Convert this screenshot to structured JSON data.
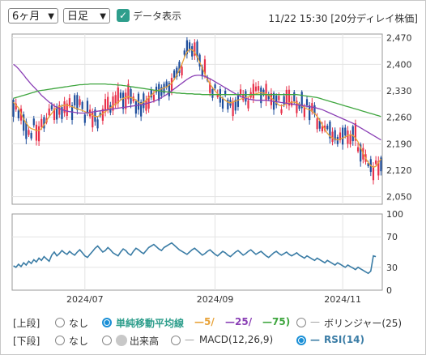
{
  "toolbar": {
    "period_select": "6ヶ月",
    "interval_select": "日足",
    "show_data_label": "データ表示",
    "show_data_checked": true,
    "datetime": "11/22 15:30 [20分ディレイ株価]"
  },
  "colors": {
    "up": "#e8304a",
    "down": "#1f4e9c",
    "ma5": "#e8a33a",
    "ma25": "#8a3fb5",
    "ma75": "#3fa63f",
    "rsi": "#3a7ca5",
    "accent": "#1a8fd6"
  },
  "chart_data": [
    {
      "type": "candlestick",
      "ylim": [
        2030,
        2480
      ],
      "yticks": [
        "2,470",
        "2,400",
        "2,330",
        "2,260",
        "2,190",
        "2,120",
        "2,050"
      ],
      "ytick_values": [
        2470,
        2400,
        2330,
        2260,
        2190,
        2120,
        2050
      ],
      "xticks": [
        "2024/07",
        "2024/09",
        "2024/11"
      ],
      "xtick_index": [
        28,
        79,
        129
      ],
      "series": [
        {
          "name": "5",
          "values": [
            2300,
            2292,
            2285,
            2270,
            2255,
            2245,
            2235,
            2230,
            2228,
            2225,
            2225,
            2230,
            2240,
            2250,
            2262,
            2270,
            2280,
            2285,
            2288,
            2290,
            2292,
            2292,
            2290,
            2288,
            2285,
            2282,
            2280,
            2278,
            2275,
            2272,
            2270,
            2265,
            2262,
            2262,
            2265,
            2270,
            2275,
            2280,
            2285,
            2290,
            2295,
            2300,
            2305,
            2310,
            2312,
            2315,
            2312,
            2310,
            2305,
            2300,
            2296,
            2300,
            2305,
            2312,
            2318,
            2325,
            2330,
            2332,
            2335,
            2338,
            2340,
            2345,
            2350,
            2360,
            2372,
            2385,
            2400,
            2418,
            2432,
            2440,
            2438,
            2432,
            2420,
            2405,
            2390,
            2375,
            2360,
            2348,
            2338,
            2330,
            2322,
            2315,
            2310,
            2305,
            2300,
            2298,
            2300,
            2303,
            2305,
            2308,
            2310,
            2312,
            2314,
            2318,
            2320,
            2322,
            2324,
            2325,
            2324,
            2322,
            2318,
            2312,
            2305,
            2298,
            2292,
            2290,
            2292,
            2295,
            2298,
            2300,
            2300,
            2298,
            2294,
            2290,
            2286,
            2282,
            2280,
            2276,
            2270,
            2262,
            2252,
            2240,
            2228,
            2218,
            2210,
            2205,
            2202,
            2200,
            2202,
            2205,
            2208,
            2212,
            2214,
            2212,
            2205,
            2195,
            2180,
            2165,
            2152,
            2140,
            2132,
            2128,
            2130,
            2140,
            2150
          ]
        },
        {
          "name": "25",
          "values": [
            2400,
            2395,
            2388,
            2380,
            2372,
            2363,
            2355,
            2347,
            2340,
            2333,
            2326,
            2318,
            2312,
            2306,
            2300,
            2295,
            2290,
            2286,
            2283,
            2280,
            2278,
            2276,
            2275,
            2274,
            2273,
            2272,
            2271,
            2271,
            2271,
            2272,
            2273,
            2274,
            2275,
            2276,
            2277,
            2278,
            2279,
            2280,
            2281,
            2282,
            2283,
            2284,
            2285,
            2286,
            2287,
            2288,
            2289,
            2290,
            2291,
            2292,
            2293,
            2294,
            2296,
            2298,
            2300,
            2302,
            2305,
            2308,
            2312,
            2316,
            2320,
            2325,
            2330,
            2335,
            2340,
            2345,
            2350,
            2355,
            2360,
            2364,
            2368,
            2370,
            2371,
            2371,
            2370,
            2368,
            2365,
            2362,
            2358,
            2354,
            2350,
            2346,
            2342,
            2338,
            2334,
            2330,
            2326,
            2322,
            2318,
            2315,
            2312,
            2310,
            2308,
            2307,
            2306,
            2305,
            2305,
            2305,
            2305,
            2305,
            2304,
            2303,
            2302,
            2301,
            2300,
            2299,
            2298,
            2297,
            2296,
            2295,
            2294,
            2293,
            2292,
            2291,
            2290,
            2289,
            2288,
            2287,
            2286,
            2284,
            2282,
            2280,
            2277,
            2274,
            2271,
            2268,
            2265,
            2262,
            2259,
            2256,
            2253,
            2250,
            2247,
            2244,
            2240,
            2236,
            2232,
            2228,
            2224,
            2220,
            2216,
            2212,
            2208,
            2204,
            2200
          ]
        },
        {
          "name": "75",
          "values": [
            2310,
            2312,
            2314,
            2316,
            2318,
            2320,
            2322,
            2324,
            2326,
            2328,
            2330,
            2331,
            2332,
            2333,
            2334,
            2335,
            2336,
            2337,
            2338,
            2339,
            2340,
            2341,
            2342,
            2343,
            2344,
            2345,
            2346,
            2346,
            2347,
            2347,
            2348,
            2348,
            2348,
            2348,
            2348,
            2348,
            2348,
            2347,
            2347,
            2346,
            2346,
            2345,
            2345,
            2344,
            2343,
            2342,
            2341,
            2340,
            2339,
            2338,
            2337,
            2336,
            2335,
            2334,
            2333,
            2332,
            2331,
            2330,
            2329,
            2328,
            2327,
            2326,
            2325,
            2325,
            2324,
            2324,
            2323,
            2323,
            2322,
            2322,
            2322,
            2321,
            2321,
            2321,
            2320,
            2320,
            2320,
            2320,
            2320,
            2320,
            2320,
            2320,
            2320,
            2320,
            2320,
            2320,
            2320,
            2320,
            2320,
            2320,
            2320,
            2320,
            2320,
            2320,
            2320,
            2320,
            2320,
            2320,
            2320,
            2320,
            2320,
            2320,
            2320,
            2320,
            2320,
            2320,
            2320,
            2320,
            2320,
            2320,
            2320,
            2320,
            2319,
            2318,
            2317,
            2316,
            2315,
            2314,
            2313,
            2312,
            2310,
            2308,
            2306,
            2304,
            2302,
            2300,
            2298,
            2296,
            2294,
            2292,
            2290,
            2288,
            2286,
            2284,
            2282,
            2280,
            2278,
            2276,
            2274,
            2272,
            2270,
            2268,
            2266,
            2264,
            2262
          ]
        }
      ]
    },
    {
      "type": "line",
      "ylim": [
        0,
        100
      ],
      "yticks": [
        "100",
        "70",
        "30",
        "0"
      ],
      "ytick_values": [
        100,
        70,
        30,
        0
      ],
      "series": [
        {
          "name": "RSI(14)",
          "values": [
            32,
            30,
            34,
            31,
            36,
            33,
            38,
            35,
            40,
            37,
            42,
            39,
            44,
            41,
            38,
            46,
            50,
            45,
            48,
            52,
            49,
            47,
            51,
            48,
            46,
            50,
            53,
            49,
            45,
            43,
            47,
            51,
            55,
            58,
            54,
            50,
            52,
            56,
            53,
            49,
            47,
            45,
            50,
            54,
            52,
            48,
            46,
            51,
            55,
            53,
            50,
            48,
            52,
            56,
            58,
            60,
            57,
            54,
            52,
            56,
            58,
            60,
            62,
            59,
            56,
            53,
            51,
            49,
            47,
            50,
            53,
            55,
            52,
            49,
            46,
            48,
            51,
            53,
            50,
            47,
            45,
            48,
            51,
            49,
            46,
            44,
            47,
            50,
            52,
            49,
            46,
            48,
            51,
            53,
            50,
            47,
            49,
            51,
            48,
            45,
            43,
            46,
            49,
            51,
            48,
            46,
            48,
            50,
            47,
            45,
            47,
            49,
            46,
            44,
            42,
            45,
            43,
            41,
            39,
            42,
            40,
            38,
            36,
            39,
            37,
            35,
            33,
            36,
            34,
            32,
            30,
            33,
            31,
            29,
            27,
            30,
            28,
            26,
            24,
            22,
            25,
            45,
            44
          ]
        }
      ]
    }
  ],
  "legend": {
    "upper": {
      "label": "[上段]",
      "none": "なし",
      "sma_label": "単純移動平均線",
      "sma_5": "5/",
      "sma_25": "25/",
      "sma_75": "75)",
      "bollinger": "ボリンジャー(25)"
    },
    "lower": {
      "label": "[下段]",
      "none": "なし",
      "volume": "出来高",
      "macd": "MACD(12,26,9)",
      "rsi": "RSI(14)"
    }
  }
}
